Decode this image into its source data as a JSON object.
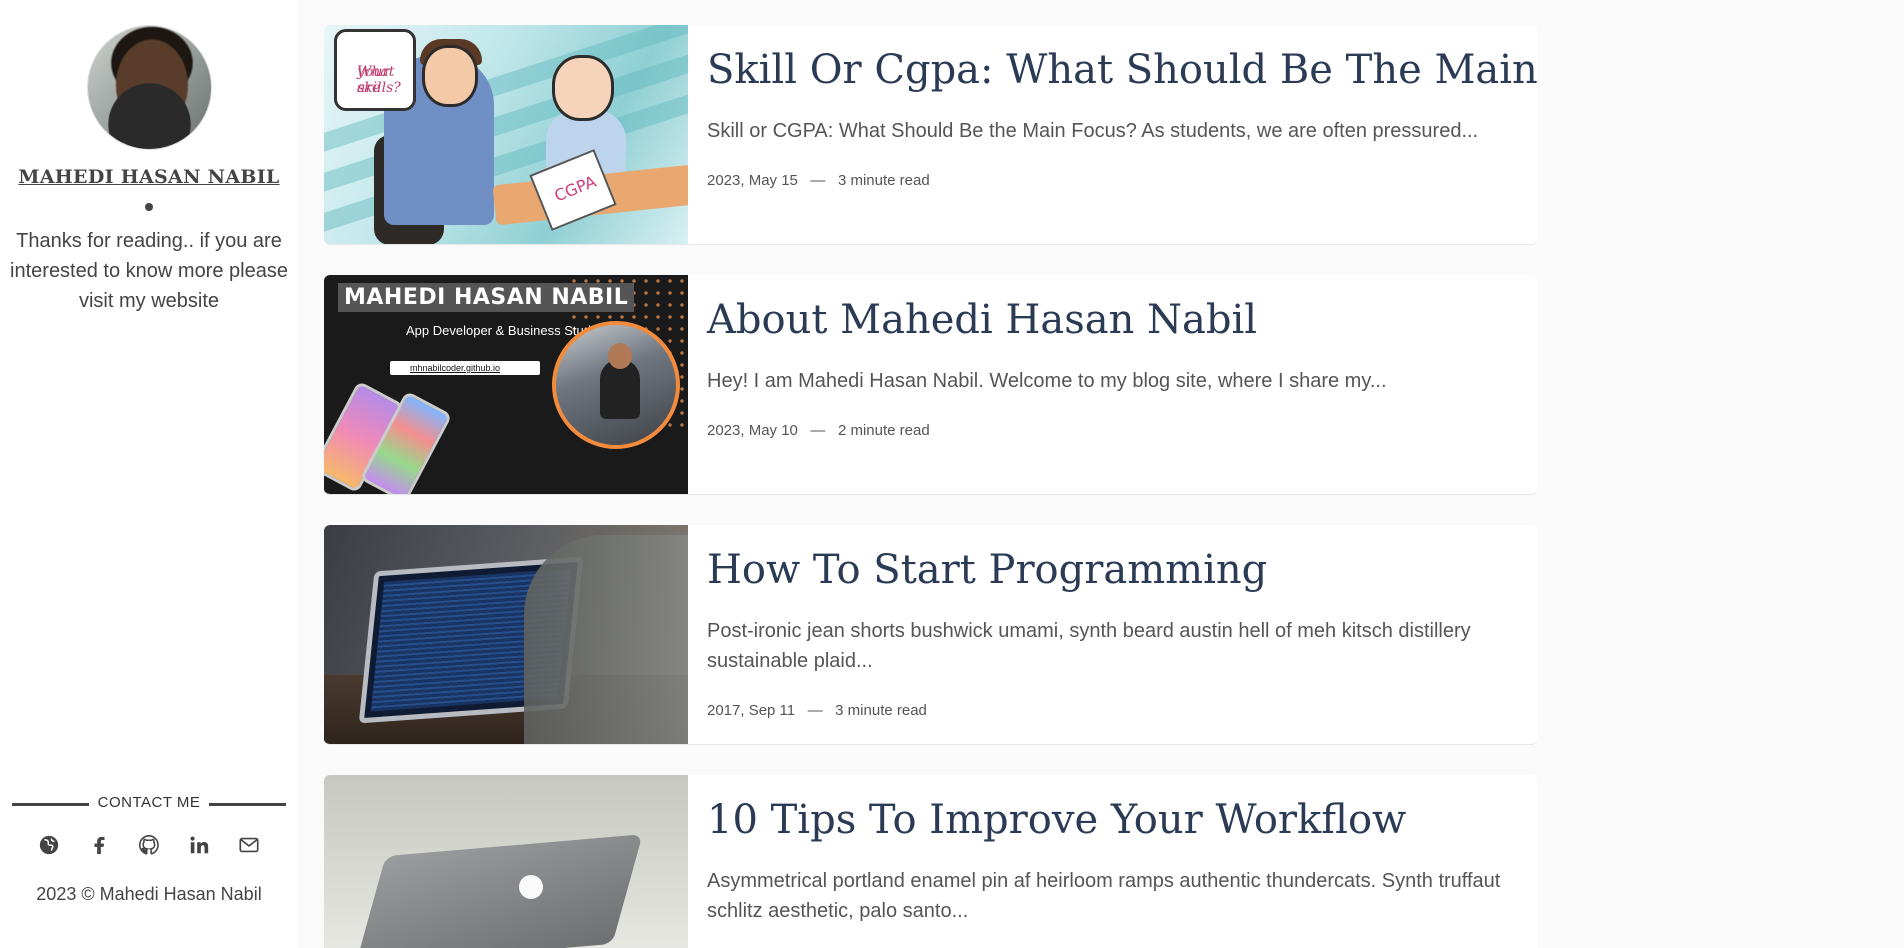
{
  "sidebar": {
    "author_name": "MAHEDI HASAN NABIL",
    "bio": "Thanks for reading.. if you are interested to know more please visit my website",
    "contact_label": "CONTACT ME",
    "social_icons": [
      "globe-icon",
      "facebook-icon",
      "github-icon",
      "linkedin-icon",
      "mail-icon"
    ],
    "copyright": "2023 © Mahedi Hasan Nabil"
  },
  "posts": [
    {
      "title": "Skill Or Cgpa: What Should Be The Main Focus",
      "excerpt": "Skill or CGPA: What Should Be the Main Focus? As students, we are often pressured...",
      "date": "2023, May 15",
      "separator": "—",
      "read_time": "3 minute read",
      "thumb": {
        "bubble_line1": "What are",
        "bubble_line2": "your skills?",
        "paper_text": "CGPA"
      }
    },
    {
      "title": "About Mahedi Hasan Nabil",
      "excerpt": "Hey! I am Mahedi Hasan Nabil. Welcome to my blog site, where I share my...",
      "date": "2023, May 10",
      "separator": "—",
      "read_time": "2 minute read",
      "thumb": {
        "banner_title": "MAHEDI HASAN NABIL",
        "banner_subtitle": "App Developer & Business Student",
        "banner_url": "mhnabilcoder.github.io"
      }
    },
    {
      "title": "How To Start Programming",
      "excerpt": "Post-ironic jean shorts bushwick umami, synth beard austin hell of meh kitsch distillery sustainable plaid...",
      "date": "2017, Sep 11",
      "separator": "—",
      "read_time": "3 minute read"
    },
    {
      "title": "10 Tips To Improve Your Workflow",
      "excerpt": "Asymmetrical portland enamel pin af heirloom ramps authentic thundercats. Synth truffaut schlitz aesthetic, palo santo..."
    }
  ],
  "colors": {
    "page_bg": "#fafafa",
    "title_color": "#2b3a55",
    "text_color": "#444444",
    "accent_orange": "#f28c3c"
  }
}
